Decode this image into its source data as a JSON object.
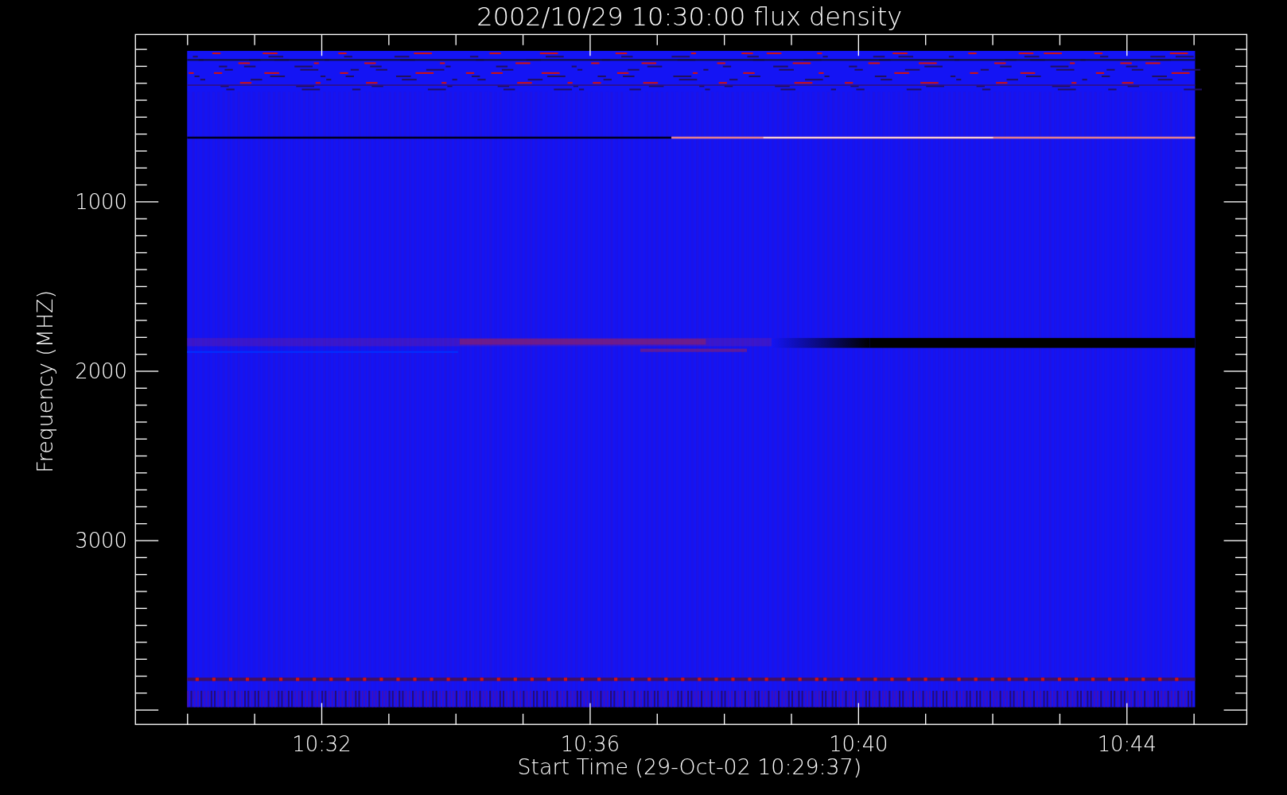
{
  "plot": {
    "title": "2002/10/29 10:30:00 flux density",
    "xlabel": "Start Time (29-Oct-02 10:29:37)",
    "ylabel": "Frequency (MHZ)",
    "xtick_labels": [
      "10:32",
      "10:36",
      "10:40",
      "10:44"
    ],
    "ytick_labels": [
      "1000",
      "2000",
      "3000"
    ]
  }
}
